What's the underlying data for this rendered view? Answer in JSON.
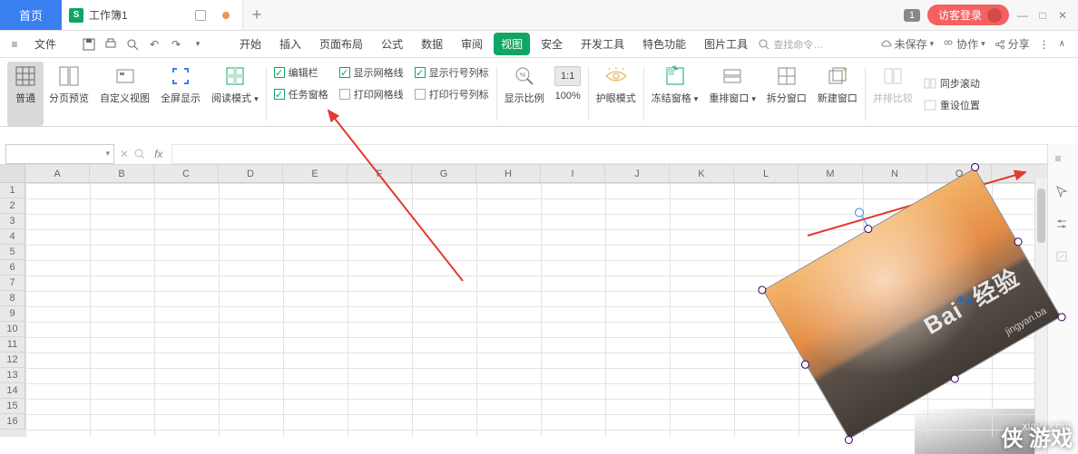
{
  "titlebar": {
    "home_tab": "首页",
    "doc_icon": "S",
    "doc_title": "工作簿1",
    "add_label": "+",
    "badge": "1",
    "login": "访客登录"
  },
  "window_controls": {
    "min": "—",
    "max": "□",
    "close": "✕"
  },
  "menubar": {
    "file": "文件",
    "items": [
      "开始",
      "插入",
      "页面布局",
      "公式",
      "数据",
      "审阅",
      "视图",
      "安全",
      "开发工具",
      "特色功能",
      "图片工具"
    ],
    "active_index": 6,
    "search_placeholder": "查找命令…",
    "right": {
      "unsaved": "未保存",
      "collab": "协作",
      "share": "分享"
    }
  },
  "ribbon": {
    "view_modes": {
      "normal": "普通",
      "page_break": "分页预览",
      "custom": "自定义视图",
      "fullscreen": "全屏显示",
      "reading": "阅读模式"
    },
    "checks": {
      "edit_bar": "编辑栏",
      "task_pane": "任务窗格",
      "show_grid": "显示网格线",
      "print_grid": "打印网格线",
      "show_headers": "显示行号列标",
      "print_headers": "打印行号列标"
    },
    "zoom": {
      "zoom_ratio": "显示比例",
      "hundred": "100%"
    },
    "eye_care": "护眼模式",
    "freeze": "冻结窗格",
    "rearrange": "重排窗口",
    "split": "拆分窗口",
    "new_window": "新建窗口",
    "compare": "并排比较",
    "sync_scroll": "同步滚动",
    "reset_pos": "重设位置"
  },
  "formula_bar": {
    "name_box": "",
    "fx": "fx"
  },
  "columns": [
    "A",
    "B",
    "C",
    "D",
    "E",
    "F",
    "G",
    "H",
    "I",
    "J",
    "K",
    "L",
    "M",
    "N",
    "O"
  ],
  "rows": [
    1,
    2,
    3,
    4,
    5,
    6,
    7,
    8,
    9,
    10,
    11,
    12,
    13,
    14,
    15,
    16
  ],
  "image_obj": {
    "logo_main": "Bai",
    "logo_sub": "经验",
    "logo_url": "jingyan.ba",
    "footer_site": "xiayx.com",
    "footer_game": "侠 游戏"
  }
}
